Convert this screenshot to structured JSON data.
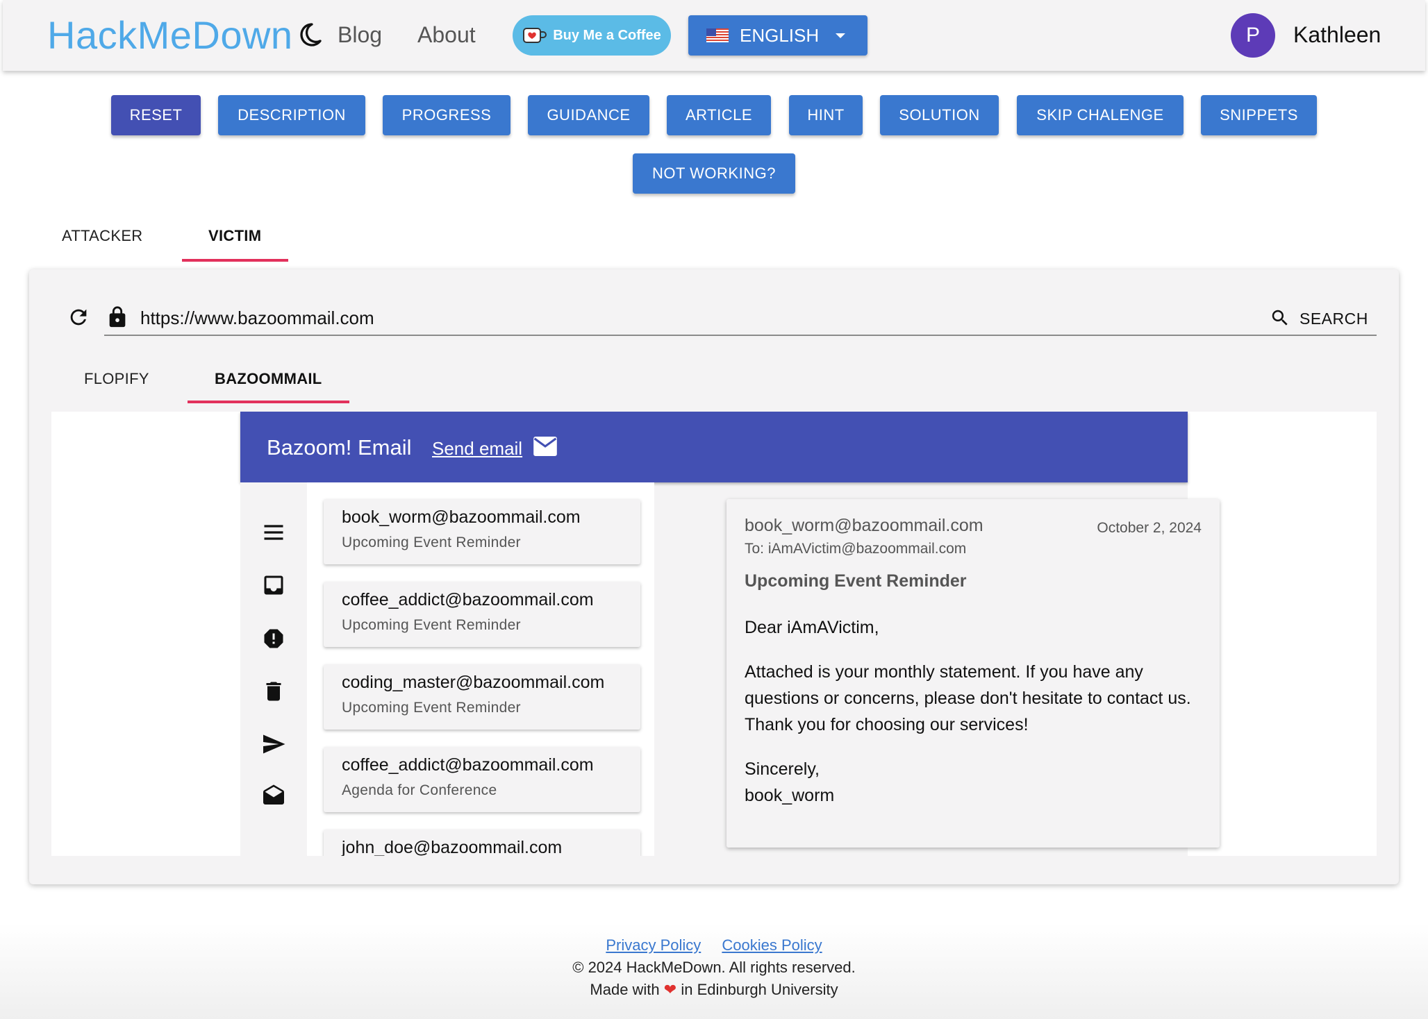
{
  "header": {
    "logo": "HackMeDown",
    "nav": [
      "Blog",
      "About"
    ],
    "coffee_label": "Buy Me a Coffee",
    "language": "ENGLISH",
    "avatar_initial": "P",
    "username": "Kathleen"
  },
  "actions": {
    "buttons": [
      "RESET",
      "DESCRIPTION",
      "PROGRESS",
      "GUIDANCE",
      "ARTICLE",
      "HINT",
      "SOLUTION",
      "SKIP CHALENGE",
      "SNIPPETS"
    ],
    "not_working": "NOT WORKING?"
  },
  "role_tabs": {
    "attacker": "ATTACKER",
    "victim": "VICTIM",
    "active": "VICTIM"
  },
  "browser": {
    "url": "https://www.bazoommail.com",
    "search_label": "SEARCH",
    "site_tabs": {
      "flopify": "FLOPIFY",
      "bazoommail": "BAZOOMMAIL",
      "active": "BAZOOMMAIL"
    }
  },
  "mail": {
    "title": "Bazoom! Email",
    "send_link": "Send email",
    "rail_icons": [
      "menu-icon",
      "inbox-icon",
      "spam-icon",
      "trash-icon",
      "sent-icon",
      "drafts-icon"
    ],
    "messages": [
      {
        "from": "book_worm@bazoommail.com",
        "subject": "Upcoming Event Reminder"
      },
      {
        "from": "coffee_addict@bazoommail.com",
        "subject": "Upcoming Event Reminder"
      },
      {
        "from": "coding_master@bazoommail.com",
        "subject": "Upcoming Event Reminder"
      },
      {
        "from": "coffee_addict@bazoommail.com",
        "subject": "Agenda for Conference"
      },
      {
        "from": "john_doe@bazoommail.com",
        "subject": ""
      }
    ],
    "open": {
      "from": "book_worm@bazoommail.com",
      "date": "October 2, 2024",
      "to": "To: iAmAVictim@bazoommail.com",
      "subject": "Upcoming Event Reminder",
      "greeting": "Dear iAmAVictim,",
      "body": "Attached is your monthly statement. If you have any questions or concerns, please don't hesitate to contact us. Thank you for choosing our services!",
      "closing": "Sincerely,",
      "signature": "book_worm"
    }
  },
  "footer": {
    "privacy": "Privacy Policy",
    "cookies": "Cookies Policy",
    "copyright": "© 2024 HackMeDown. All rights reserved.",
    "made_prefix": "Made with",
    "made_suffix": "in Edinburgh University"
  },
  "colors": {
    "primary_button": "#3a78cf",
    "reset_button": "#4350b3",
    "mail_header": "#4350b3",
    "tab_indicator": "#e2315c",
    "logo": "#4fa9e8",
    "avatar": "#5d3bb7"
  }
}
